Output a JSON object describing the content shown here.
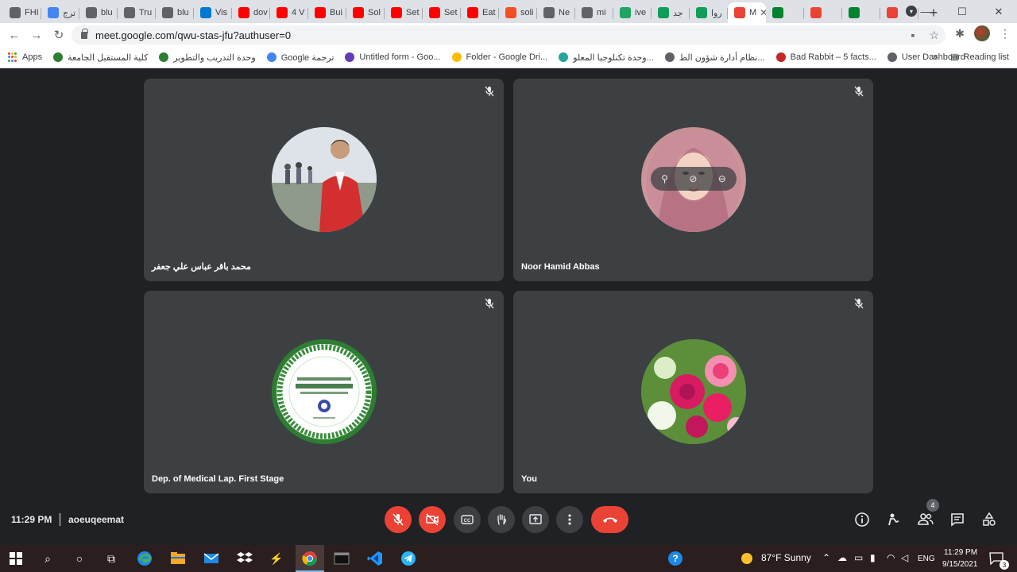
{
  "browser": {
    "tabs": [
      {
        "label": "FHI",
        "color": "#5f6368"
      },
      {
        "label": "ترج",
        "color": "#4285f4"
      },
      {
        "label": "blu",
        "color": "#5f6368"
      },
      {
        "label": "Tru",
        "color": "#5f6368"
      },
      {
        "label": "blu",
        "color": "#5f6368"
      },
      {
        "label": "Vis",
        "color": "#0078d4"
      },
      {
        "label": "dov",
        "color": "#ff0000"
      },
      {
        "label": "4 V",
        "color": "#ff0000"
      },
      {
        "label": "Bui",
        "color": "#ff0000"
      },
      {
        "label": "Sol",
        "color": "#ff0000"
      },
      {
        "label": "Set",
        "color": "#ff0000"
      },
      {
        "label": "Set",
        "color": "#ff0000"
      },
      {
        "label": "Eat",
        "color": "#ff0000"
      },
      {
        "label": "soli",
        "color": "#f25022"
      },
      {
        "label": "Ne",
        "color": "#5f6368"
      },
      {
        "label": "mi",
        "color": "#5f6368"
      },
      {
        "label": "ive",
        "color": "#1fa463"
      },
      {
        "label": "جد",
        "color": "#0f9d58"
      },
      {
        "label": "روا",
        "color": "#0f9d58"
      },
      {
        "label": "M",
        "color": "#ea4335",
        "active": true
      },
      {
        "label": "",
        "color": "#00832d"
      },
      {
        "label": "",
        "color": "#ea4335"
      },
      {
        "label": "",
        "color": "#00832d"
      },
      {
        "label": "",
        "color": "#ea4335"
      }
    ],
    "new_tab": "+",
    "url": "meet.google.com/qwu-stas-jfu?authuser=0",
    "bookmarks": [
      {
        "label": "كلية المستقبل الجامعة",
        "color": "#2e7d32"
      },
      {
        "label": "وحدة التدريب والتطوير",
        "color": "#2e7d32"
      },
      {
        "label": "Google ترجمة",
        "color": "#4285f4"
      },
      {
        "label": "Untitled form - Goo...",
        "color": "#673ab7"
      },
      {
        "label": "Folder - Google Dri...",
        "color": "#fbbc04"
      },
      {
        "label": "وحدة تكنلوجيا المعلو...",
        "color": "#26a69a"
      },
      {
        "label": "نظام أدارة شؤون الط...",
        "color": "#5f6368"
      },
      {
        "label": "Bad Rabbit – 5 facts...",
        "color": "#c62828"
      },
      {
        "label": "User Dashboard",
        "color": "#5f6368"
      }
    ],
    "apps_label": "Apps",
    "overflow": "»",
    "reading_list": "Reading list"
  },
  "meet": {
    "participants": [
      {
        "name": "محمد باقر عباس علي جعفر",
        "avatar": "man"
      },
      {
        "name": "Noor Hamid Abbas",
        "avatar": "woman"
      },
      {
        "name": "Dep. of Medical Lap. First Stage",
        "avatar": "logo"
      },
      {
        "name": "You",
        "avatar": "flowers"
      }
    ],
    "time": "11:29 PM",
    "meeting_code": "aoeuqeemat",
    "people_count": "4"
  },
  "taskbar": {
    "weather": "87°F  Sunny",
    "language": "ENG",
    "time": "11:29 PM",
    "date": "9/15/2021",
    "notification_count": "3"
  }
}
